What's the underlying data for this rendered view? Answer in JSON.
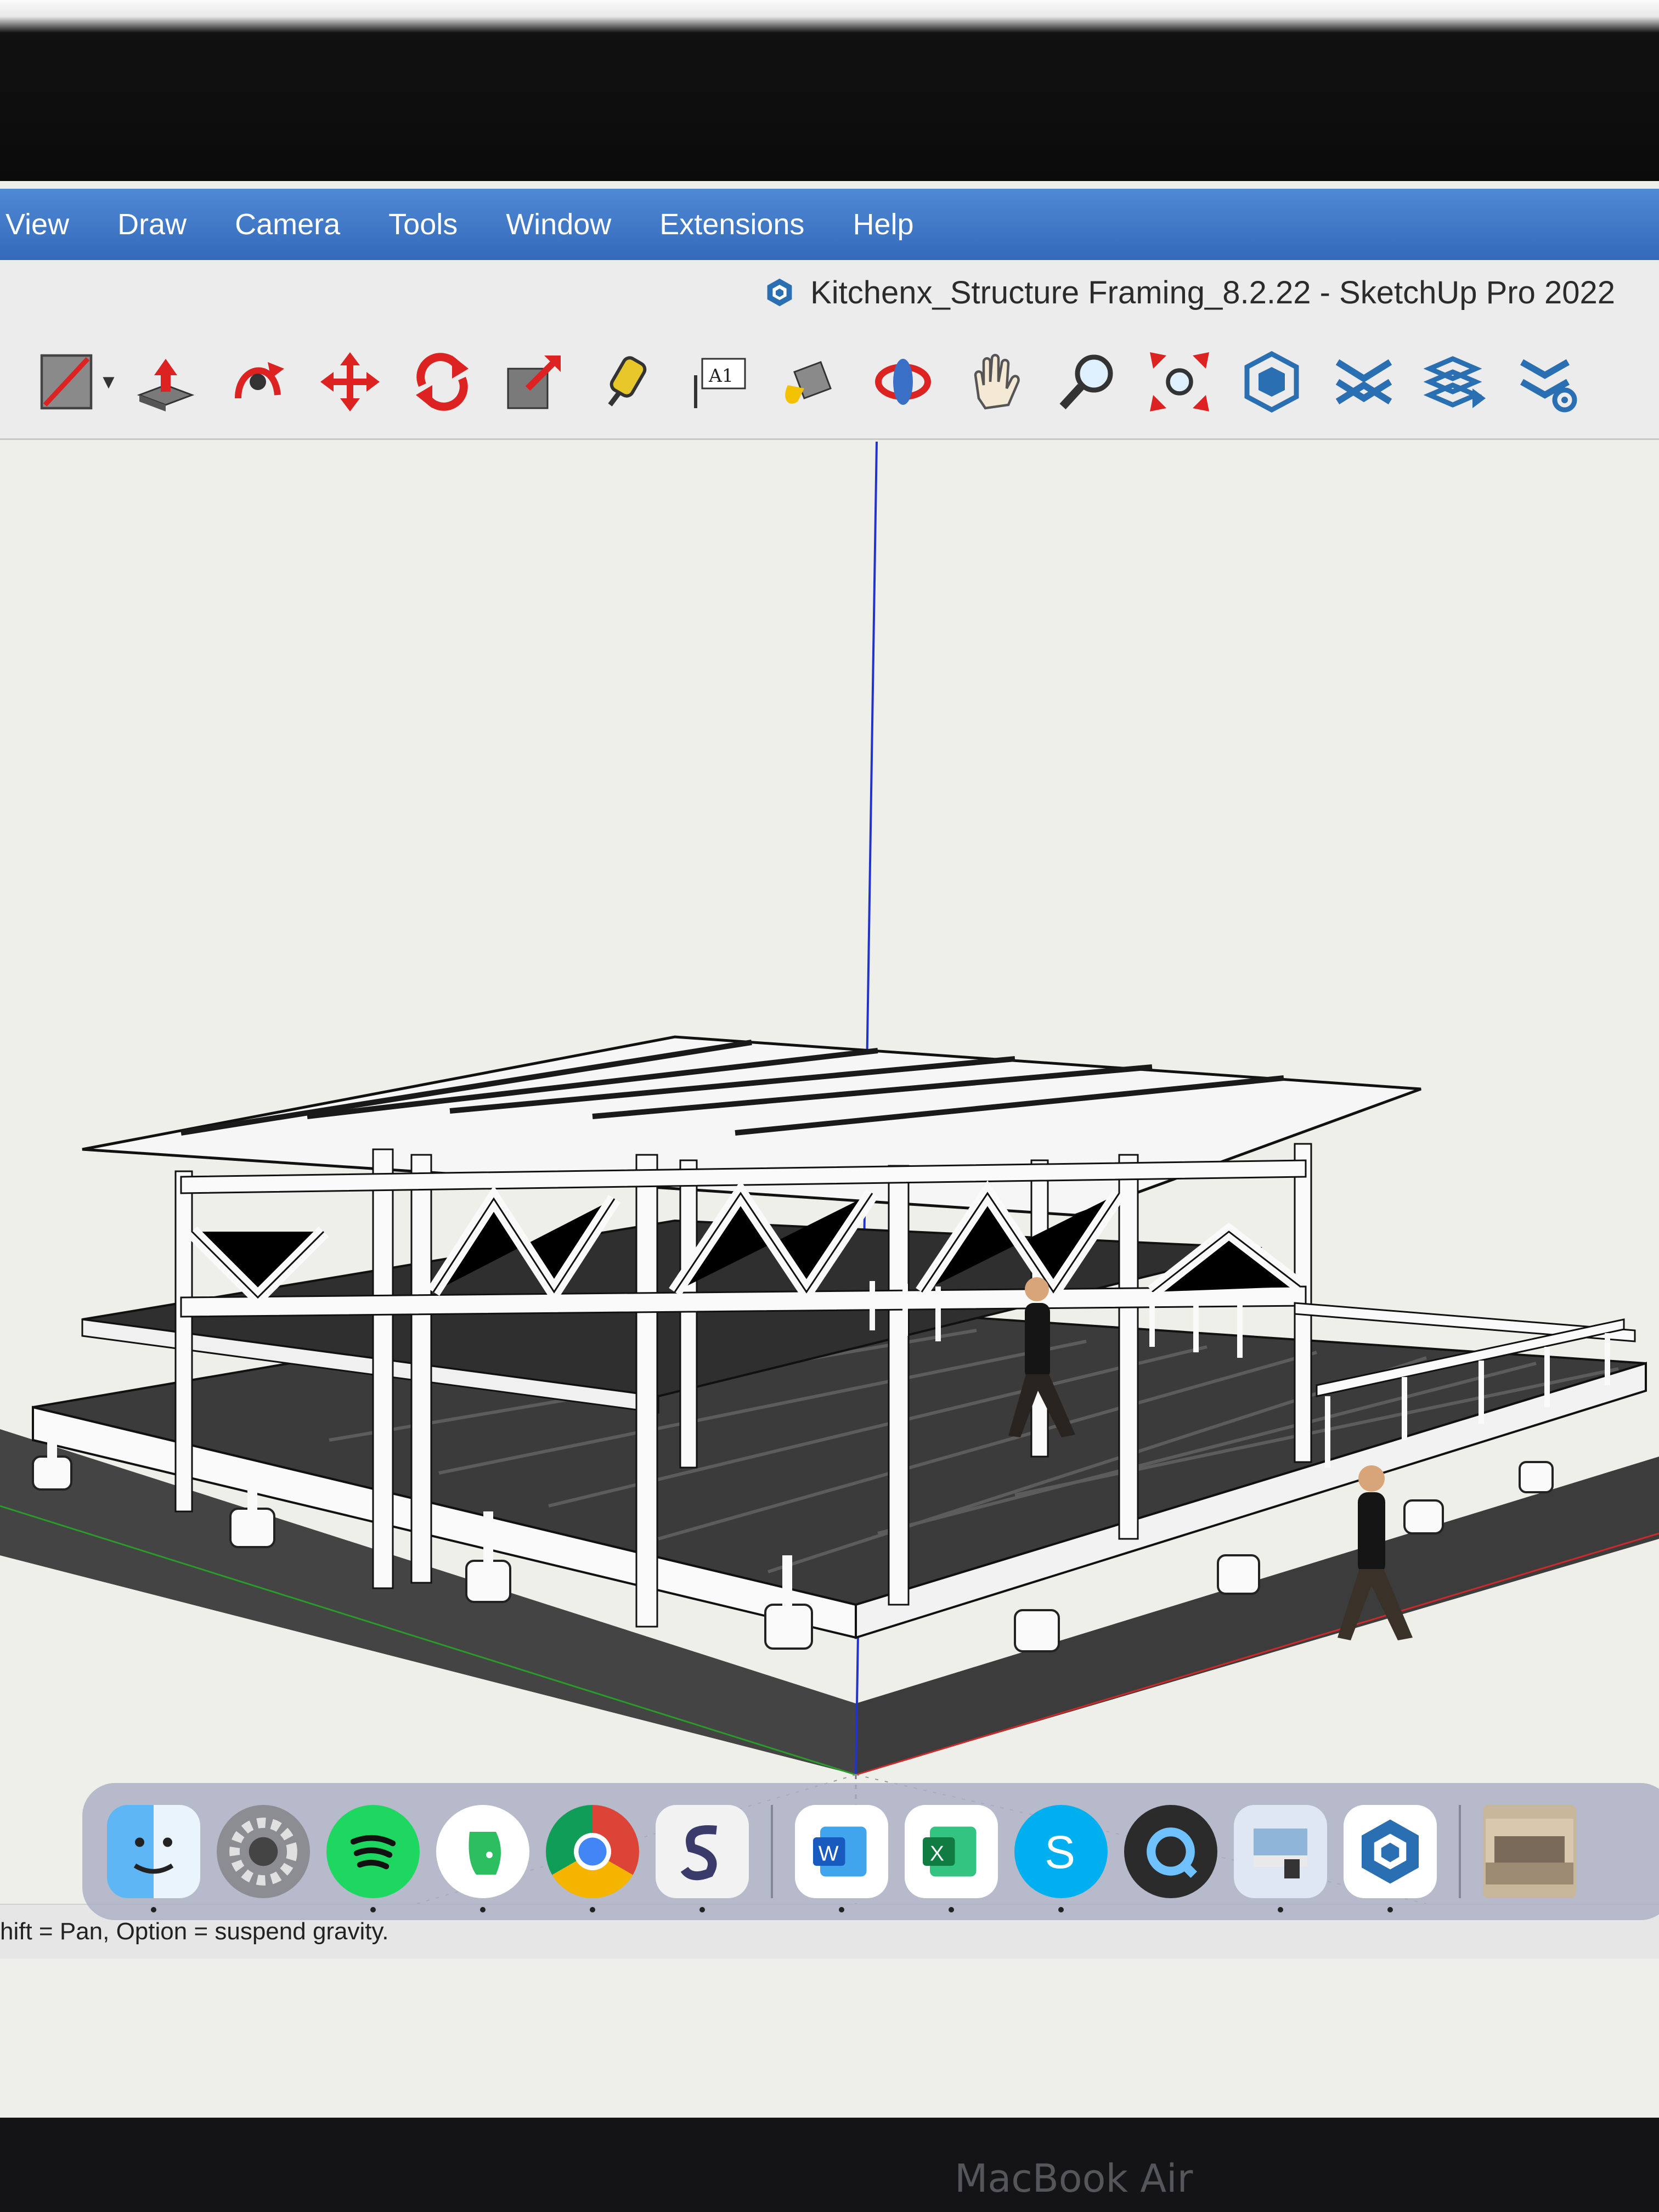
{
  "menu": {
    "items": [
      {
        "id": "view",
        "label": "View"
      },
      {
        "id": "draw",
        "label": "Draw"
      },
      {
        "id": "camera",
        "label": "Camera"
      },
      {
        "id": "tools",
        "label": "Tools"
      },
      {
        "id": "window",
        "label": "Window"
      },
      {
        "id": "extensions",
        "label": "Extensions"
      },
      {
        "id": "help",
        "label": "Help"
      }
    ]
  },
  "window": {
    "title": "Kitchenx_Structure Framing_8.2.22 - SketchUp Pro 2022",
    "app_icon": "sketchup-icon"
  },
  "toolbar": {
    "tools": [
      {
        "name": "line-icon",
        "dropdown": true
      },
      {
        "name": "push-pull-icon"
      },
      {
        "name": "follow-me-icon"
      },
      {
        "name": "move-icon"
      },
      {
        "name": "rotate-icon"
      },
      {
        "name": "scale-icon"
      },
      {
        "name": "tape-measure-icon"
      },
      {
        "name": "text-icon"
      },
      {
        "name": "paint-bucket-icon"
      },
      {
        "name": "orbit-icon"
      },
      {
        "name": "pan-icon"
      },
      {
        "name": "zoom-icon"
      },
      {
        "name": "zoom-extents-icon"
      },
      {
        "name": "3d-warehouse-icon"
      },
      {
        "name": "extension-warehouse-icon"
      },
      {
        "name": "layout-send-icon"
      },
      {
        "name": "extension-manager-icon"
      }
    ],
    "text_tool_label": "A1"
  },
  "status": {
    "text": "hift = Pan, Option = suspend gravity."
  },
  "dock": {
    "apps": [
      "finder-icon",
      "system-preferences-icon",
      "spotify-icon",
      "evernote-icon",
      "chrome-icon",
      "scrivener-icon",
      "word-icon",
      "excel-icon",
      "skype-icon",
      "quicktime-icon",
      "preview-icon",
      "sketchup-icon",
      "photos-icon"
    ]
  },
  "hardware": {
    "brand": "MacBook Air"
  },
  "colors": {
    "menubar": "#3f78c8",
    "axis_blue": "#2233cc",
    "axis_red": "#cc2a2a",
    "axis_green": "#2a9a2a"
  }
}
